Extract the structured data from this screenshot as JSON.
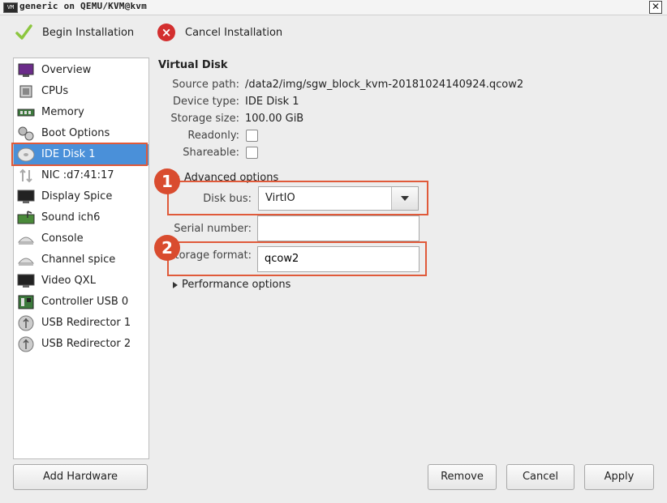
{
  "window": {
    "title": "generic on QEMU/KVM@kvm",
    "app_icon_text": "VM",
    "close_glyph": "✕"
  },
  "toolbar": {
    "begin_label": "Begin Installation",
    "cancel_label": "Cancel Installation"
  },
  "sidebar": {
    "items": [
      {
        "label": "Overview",
        "icon": "overview-icon"
      },
      {
        "label": "CPUs",
        "icon": "cpu-icon"
      },
      {
        "label": "Memory",
        "icon": "memory-icon"
      },
      {
        "label": "Boot Options",
        "icon": "boot-options-icon"
      },
      {
        "label": "IDE Disk 1",
        "icon": "disk-icon",
        "selected": true
      },
      {
        "label": "NIC :d7:41:17",
        "icon": "nic-icon"
      },
      {
        "label": "Display Spice",
        "icon": "display-icon"
      },
      {
        "label": "Sound ich6",
        "icon": "sound-icon"
      },
      {
        "label": "Console",
        "icon": "console-icon"
      },
      {
        "label": "Channel spice",
        "icon": "channel-icon"
      },
      {
        "label": "Video QXL",
        "icon": "video-icon"
      },
      {
        "label": "Controller USB 0",
        "icon": "controller-icon"
      },
      {
        "label": "USB Redirector 1",
        "icon": "usb-icon"
      },
      {
        "label": "USB Redirector 2",
        "icon": "usb-icon"
      }
    ]
  },
  "disk": {
    "title": "Virtual Disk",
    "source_path_label": "Source path:",
    "source_path": "/data2/img/sgw_block_kvm-20181024140924.qcow2",
    "device_type_label": "Device type:",
    "device_type": "IDE Disk 1",
    "storage_size_label": "Storage size:",
    "storage_size": "100.00 GiB",
    "readonly_label": "Readonly:",
    "shareable_label": "Shareable:",
    "advanced_label": "Advanced options",
    "disk_bus_label": "Disk bus:",
    "disk_bus": "VirtIO",
    "serial_label": "Serial number:",
    "serial_value": "",
    "storage_format_label": "Storage format:",
    "storage_format": "qcow2",
    "performance_label": "Performance options"
  },
  "annotations": {
    "badge1": "1",
    "badge2": "2"
  },
  "buttons": {
    "add_hardware": "Add Hardware",
    "remove": "Remove",
    "cancel": "Cancel",
    "apply": "Apply"
  },
  "colors": {
    "selection": "#4a90d9",
    "highlight": "#e05a3a",
    "badge": "#d94c2f"
  }
}
